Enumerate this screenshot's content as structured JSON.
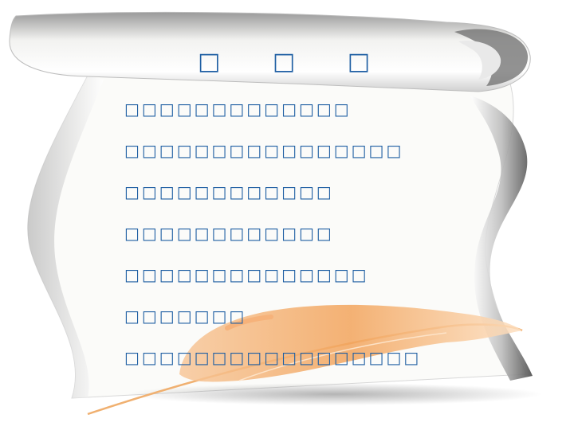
{
  "colors": {
    "text": "#1f5fa3",
    "paper": "#fbfbf9",
    "paper_shadow": "#a8a8a8",
    "feather": "#f4a35a"
  },
  "icons": {
    "decor": "parchment-scroll-with-quill"
  },
  "slide": {
    "title": "□ □ □",
    "lines": [
      "□□□□□□□□□□□□□",
      "□□□□□□□□□□□□□□□□",
      "□□□□□□□□□□□□",
      "□□□□□□□□□□□□",
      "□□□□□□□□□□□□□□",
      "□□□□□□□",
      "□□□□□□□□□□□□□□□□□"
    ]
  }
}
